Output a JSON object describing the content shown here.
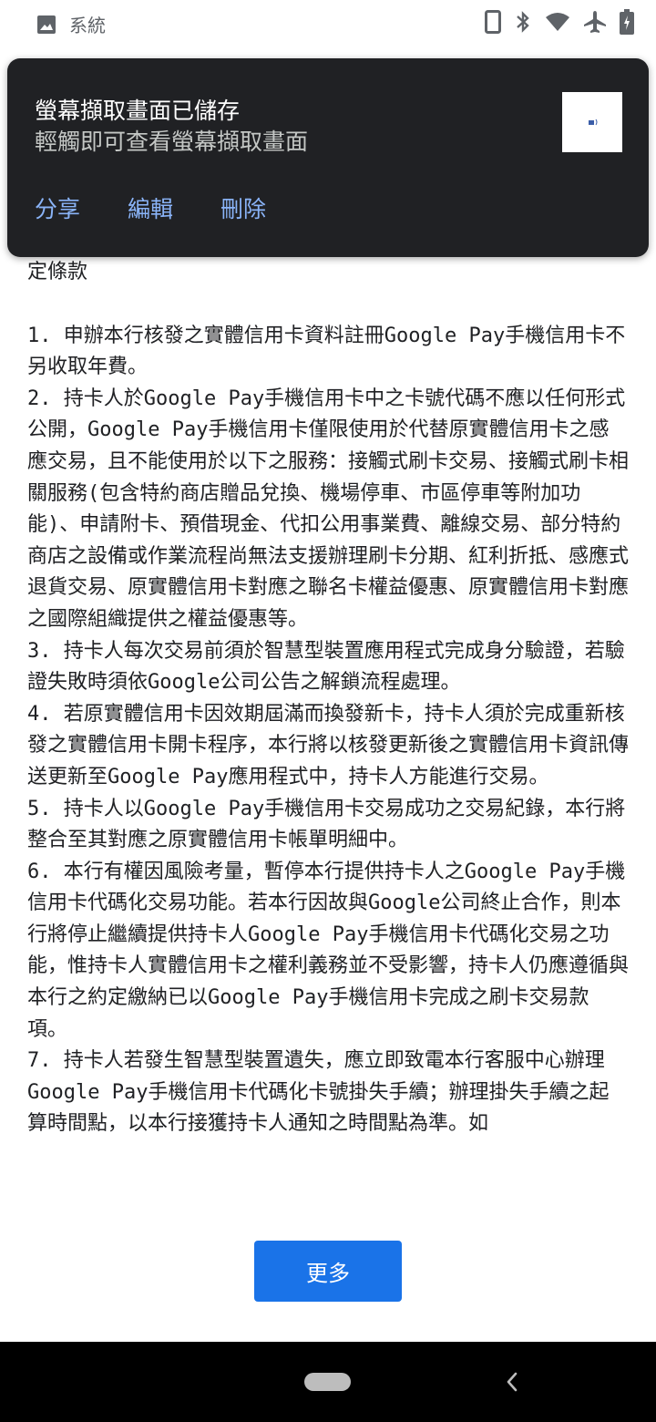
{
  "status_bar": {
    "notification_label": "系統",
    "icons": [
      "image-icon",
      "phone-icon",
      "bluetooth-icon",
      "wifi-icon",
      "airplane-icon",
      "battery-icon"
    ]
  },
  "notification": {
    "title": "螢幕擷取畫面已儲存",
    "subtitle": "輕觸即可查看螢幕擷取畫面",
    "actions": {
      "share": "分享",
      "edit": "編輯",
      "delete": "刪除"
    }
  },
  "content": {
    "partial_heading": "定條款",
    "paragraphs": [
      "1. 申辦本行核發之實體信用卡資料註冊Google Pay手機信用卡不另收取年費。",
      "2. 持卡人於Google Pay手機信用卡中之卡號代碼不應以任何形式公開，Google Pay手機信用卡僅限使用於代替原實體信用卡之感應交易，且不能使用於以下之服務：接觸式刷卡交易、接觸式刷卡相關服務(包含特約商店贈品兌換、機場停車、市區停車等附加功能)、申請附卡、預借現金、代扣公用事業費、離線交易、部分特約商店之設備或作業流程尚無法支援辦理刷卡分期、紅利折抵、感應式退貨交易、原實體信用卡對應之聯名卡權益優惠、原實體信用卡對應之國際組織提供之權益優惠等。",
      "3. 持卡人每次交易前須於智慧型裝置應用程式完成身分驗證，若驗證失敗時須依Google公司公告之解鎖流程處理。",
      "4. 若原實體信用卡因效期屆滿而換發新卡，持卡人須於完成重新核發之實體信用卡開卡程序，本行將以核發更新後之實體信用卡資訊傳送更新至Google Pay應用程式中，持卡人方能進行交易。",
      "5. 持卡人以Google Pay手機信用卡交易成功之交易紀錄，本行將整合至其對應之原實體信用卡帳單明細中。",
      "6. 本行有權因風險考量，暫停本行提供持卡人之Google Pay手機信用卡代碼化交易功能。若本行因故與Google公司終止合作，則本行將停止繼續提供持卡人Google Pay手機信用卡代碼化交易之功能，惟持卡人實體信用卡之權利義務並不受影響，持卡人仍應遵循與本行之約定繳納已以Google Pay手機信用卡完成之刷卡交易款項。",
      "7. 持卡人若發生智慧型裝置遺失，應立即致電本行客服中心辦理Google Pay手機信用卡代碼化卡號掛失手續；辦理掛失手續之起算時間點，以本行接獲持卡人通知之時間點為準。如"
    ]
  },
  "more_button": {
    "label": "更多"
  },
  "colors": {
    "notification_bg": "#202124",
    "action_link": "#8ab4f8",
    "primary_button": "#1a73e8",
    "nav_bar": "#000000"
  }
}
